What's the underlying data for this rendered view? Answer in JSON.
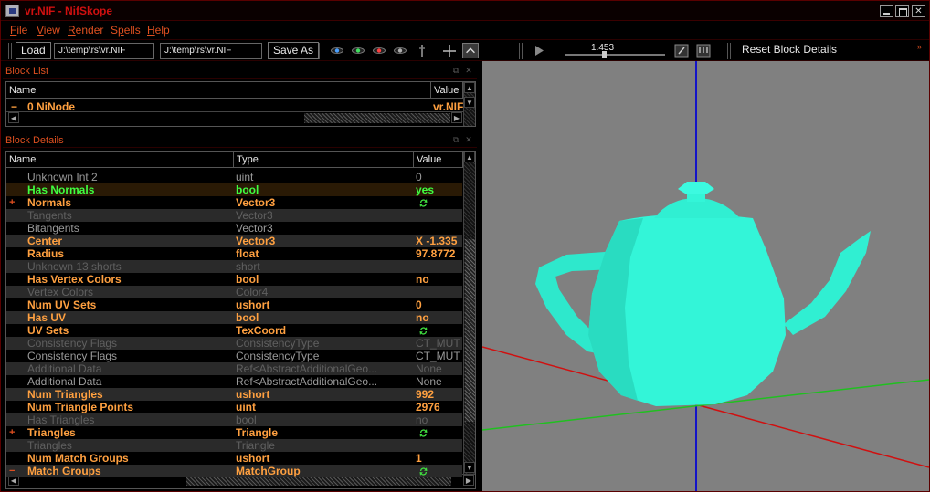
{
  "window": {
    "title": "vr.NIF - NifSkope"
  },
  "menu": [
    {
      "pre": "",
      "ul": "F",
      "post": "ile"
    },
    {
      "pre": "",
      "ul": "V",
      "post": "iew"
    },
    {
      "pre": "",
      "ul": "R",
      "post": "ender"
    },
    {
      "pre": "S",
      "ul": "p",
      "post": "ells"
    },
    {
      "pre": "",
      "ul": "H",
      "post": "elp"
    }
  ],
  "toolbar": {
    "load_label": "Load",
    "load_path": "J:\\temp\\rs\\vr.NIF",
    "save_path": "J:\\temp\\rs\\vr.NIF",
    "save_as_label": "Save As",
    "time_value": "1.453",
    "reset_label": "Reset Block Details",
    "icons": [
      "view-eye-blue-icon",
      "view-eye-green-icon",
      "view-eye-red-icon",
      "view-eye-gray-icon",
      "axis-icon",
      "pan-icon",
      "rotate-icon",
      "play-icon",
      "keyframe-icon",
      "loop-icon"
    ]
  },
  "block_list": {
    "title": "Block List",
    "columns": [
      "Name",
      "Value"
    ],
    "rows": [
      {
        "expander": "−",
        "name": "0 NiNode",
        "value": "vr.NIF"
      }
    ]
  },
  "block_details": {
    "title": "Block Details",
    "columns": [
      "Name",
      "Type",
      "Value"
    ],
    "rows": [
      {
        "expander": "",
        "name": "Unknown Int 2",
        "type": "uint",
        "value": "0",
        "state": "dim2"
      },
      {
        "expander": "",
        "name": "Has Normals",
        "type": "bool",
        "value": "yes",
        "state": "green"
      },
      {
        "expander": "+",
        "name": "Normals",
        "type": "Vector3",
        "value": "",
        "icon": true,
        "state": "active"
      },
      {
        "expander": "",
        "name": "Tangents",
        "type": "Vector3",
        "value": "",
        "state": "dim"
      },
      {
        "expander": "",
        "name": "Bitangents",
        "type": "Vector3",
        "value": "",
        "state": "dim2"
      },
      {
        "expander": "",
        "name": "Center",
        "type": "Vector3",
        "value": "X -1.335",
        "state": "active"
      },
      {
        "expander": "",
        "name": "Radius",
        "type": "float",
        "value": "97.8772",
        "state": "active"
      },
      {
        "expander": "",
        "name": "Unknown 13 shorts",
        "type": "short",
        "value": "",
        "state": "dim"
      },
      {
        "expander": "",
        "name": "Has Vertex Colors",
        "type": "bool",
        "value": "no",
        "state": "active"
      },
      {
        "expander": "",
        "name": "Vertex Colors",
        "type": "Color4",
        "value": "",
        "state": "dim"
      },
      {
        "expander": "",
        "name": "Num UV Sets",
        "type": "ushort",
        "value": "0",
        "state": "active"
      },
      {
        "expander": "",
        "name": "Has UV",
        "type": "bool",
        "value": "no",
        "state": "active"
      },
      {
        "expander": "",
        "name": "UV Sets",
        "type": "TexCoord",
        "value": "",
        "icon": true,
        "state": "active"
      },
      {
        "expander": "",
        "name": "Consistency Flags",
        "type": "ConsistencyType",
        "value": "CT_MUT",
        "state": "dim"
      },
      {
        "expander": "",
        "name": "Consistency Flags",
        "type": "ConsistencyType",
        "value": "CT_MUT",
        "state": "dim2"
      },
      {
        "expander": "",
        "name": "Additional Data",
        "type": "Ref<AbstractAdditionalGeo...",
        "value": "None",
        "state": "dim"
      },
      {
        "expander": "",
        "name": "Additional Data",
        "type": "Ref<AbstractAdditionalGeo...",
        "value": "None",
        "state": "dim2"
      },
      {
        "expander": "",
        "name": "Num Triangles",
        "type": "ushort",
        "value": "992",
        "state": "active"
      },
      {
        "expander": "",
        "name": "Num Triangle Points",
        "type": "uint",
        "value": "2976",
        "state": "active"
      },
      {
        "expander": "",
        "name": "Has Triangles",
        "type": "bool",
        "value": "no",
        "state": "dim"
      },
      {
        "expander": "+",
        "name": "Triangles",
        "type": "Triangle",
        "value": "",
        "icon": true,
        "state": "active"
      },
      {
        "expander": "",
        "name": "Triangles",
        "type": "Triangle",
        "value": "",
        "state": "dim"
      },
      {
        "expander": "",
        "name": "Num Match Groups",
        "type": "ushort",
        "value": "1",
        "state": "active"
      },
      {
        "expander": "−",
        "name": "Match Groups",
        "type": "MatchGroup",
        "value": "",
        "icon": true,
        "state": "active"
      }
    ]
  },
  "colors": {
    "title_red": "#d01010",
    "menu_orange": "#e05020",
    "active_orange": "#ffa040",
    "green": "#40ff40",
    "teapot": "#33f5d8",
    "viewport_bg": "#808080"
  }
}
